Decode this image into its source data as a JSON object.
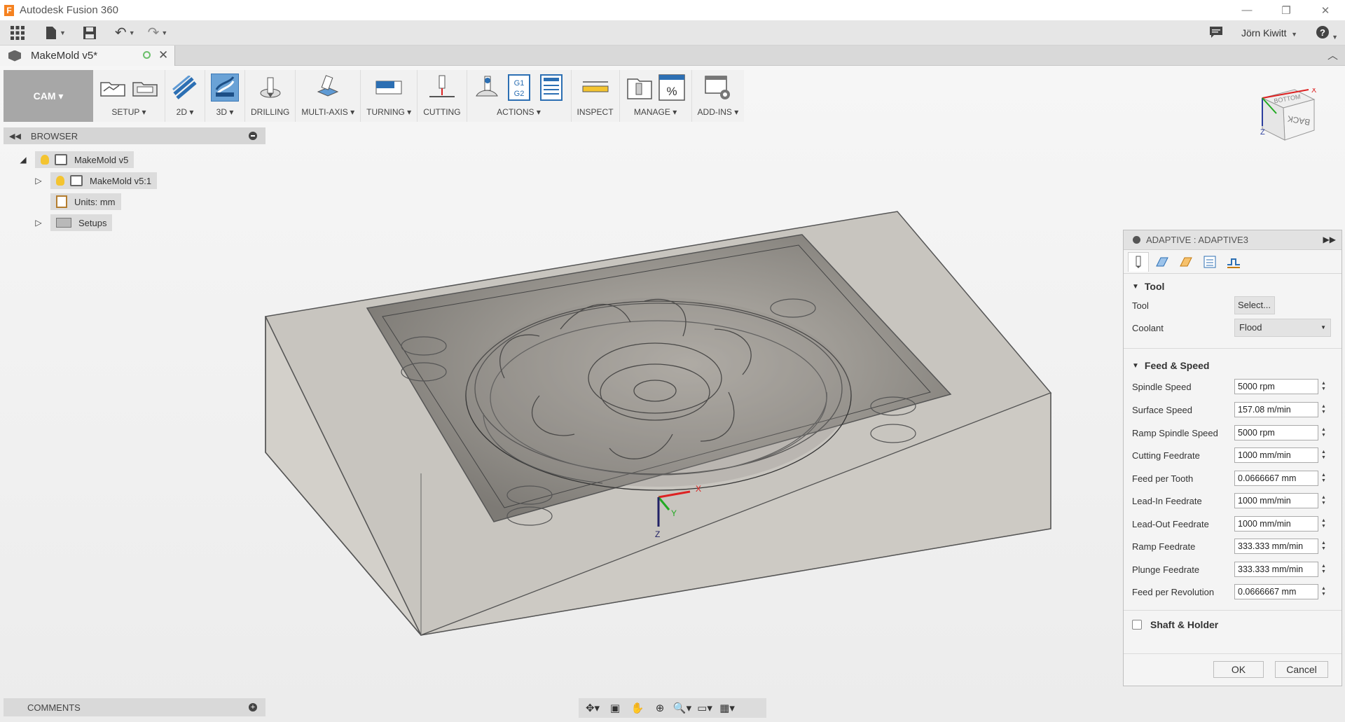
{
  "app": {
    "title": "Autodesk Fusion 360",
    "logo_letter": "F"
  },
  "quick_access": {
    "user": "Jörn Kiwitt"
  },
  "document": {
    "tab_name": "MakeMold v5*"
  },
  "toolbar": {
    "workspace": "CAM",
    "groups": [
      {
        "label": "SETUP",
        "dropdown": true
      },
      {
        "label": "2D",
        "dropdown": true
      },
      {
        "label": "3D",
        "dropdown": true
      },
      {
        "label": "DRILLING",
        "dropdown": false
      },
      {
        "label": "MULTI-AXIS",
        "dropdown": true
      },
      {
        "label": "TURNING",
        "dropdown": true
      },
      {
        "label": "CUTTING",
        "dropdown": false
      },
      {
        "label": "ACTIONS",
        "dropdown": true
      },
      {
        "label": "INSPECT",
        "dropdown": false
      },
      {
        "label": "MANAGE",
        "dropdown": true
      },
      {
        "label": "ADD-INS",
        "dropdown": true
      }
    ],
    "actions_g_code": [
      "G1",
      "G2"
    ],
    "manage_percent": "%"
  },
  "browser": {
    "title": "BROWSER",
    "items": [
      {
        "label": "MakeMold v5"
      },
      {
        "label": "MakeMold v5:1"
      },
      {
        "label": "Units: mm"
      },
      {
        "label": "Setups"
      }
    ]
  },
  "comments": {
    "title": "COMMENTS"
  },
  "viewcube": {
    "top": "BOTTOM",
    "front": "BACK",
    "x_axis": "X",
    "z_axis": "Z"
  },
  "triad": {
    "x": "X",
    "y": "Y",
    "z": "Z"
  },
  "adaptive": {
    "title": "ADAPTIVE : ADAPTIVE3",
    "tool_section": "Tool",
    "tool_label": "Tool",
    "tool_button": "Select...",
    "coolant_label": "Coolant",
    "coolant_value": "Flood",
    "feed_section": "Feed & Speed",
    "params": [
      {
        "label": "Spindle Speed",
        "value": "5000 rpm"
      },
      {
        "label": "Surface Speed",
        "value": "157.08 m/min"
      },
      {
        "label": "Ramp Spindle Speed",
        "value": "5000 rpm"
      },
      {
        "label": "Cutting Feedrate",
        "value": "1000 mm/min"
      },
      {
        "label": "Feed per Tooth",
        "value": "0.0666667 mm"
      },
      {
        "label": "Lead-In Feedrate",
        "value": "1000 mm/min"
      },
      {
        "label": "Lead-Out Feedrate",
        "value": "1000 mm/min"
      },
      {
        "label": "Ramp Feedrate",
        "value": "333.333 mm/min"
      },
      {
        "label": "Plunge Feedrate",
        "value": "333.333 mm/min"
      },
      {
        "label": "Feed per Revolution",
        "value": "0.0666667 mm"
      }
    ],
    "shaft_section": "Shaft & Holder",
    "ok": "OK",
    "cancel": "Cancel"
  }
}
